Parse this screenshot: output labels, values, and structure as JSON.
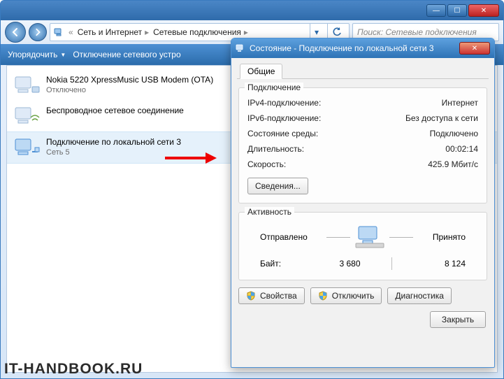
{
  "window": {
    "min": "—",
    "max": "☐",
    "close": "✕"
  },
  "address": {
    "crumb1": "Сеть и Интернет",
    "crumb2": "Сетевые подключения",
    "search_placeholder": "Поиск: Сетевые подключения"
  },
  "toolbar": {
    "organize": "Упорядочить",
    "disable": "Отключение сетевого устро"
  },
  "netlist": {
    "items": [
      {
        "name": "Nokia 5220 XpressMusic USB Modem (OTA)",
        "sub": "Отключено"
      },
      {
        "name": "Беспроводное сетевое соединение",
        "sub": ""
      },
      {
        "name": "Подключение по локальной сети 3",
        "sub": "Сеть 5"
      }
    ]
  },
  "dialog": {
    "title": "Состояние - Подключение по локальной сети 3",
    "tab": "Общие",
    "group_conn": "Подключение",
    "rows": {
      "ipv4_k": "IPv4-подключение:",
      "ipv4_v": "Интернет",
      "ipv6_k": "IPv6-подключение:",
      "ipv6_v": "Без доступа к сети",
      "media_k": "Состояние среды:",
      "media_v": "Подключено",
      "dur_k": "Длительность:",
      "dur_v": "00:02:14",
      "speed_k": "Скорость:",
      "speed_v": "425.9 Мбит/с"
    },
    "details_btn": "Сведения...",
    "group_act": "Активность",
    "sent_label": "Отправлено",
    "recv_label": "Принято",
    "bytes_label": "Байт:",
    "bytes_sent": "3 680",
    "bytes_recv": "8 124",
    "btn_props": "Свойства",
    "btn_disable": "Отключить",
    "btn_diag": "Диагностика",
    "btn_close": "Закрыть"
  },
  "watermark": "IT-HANDBOOK.RU"
}
